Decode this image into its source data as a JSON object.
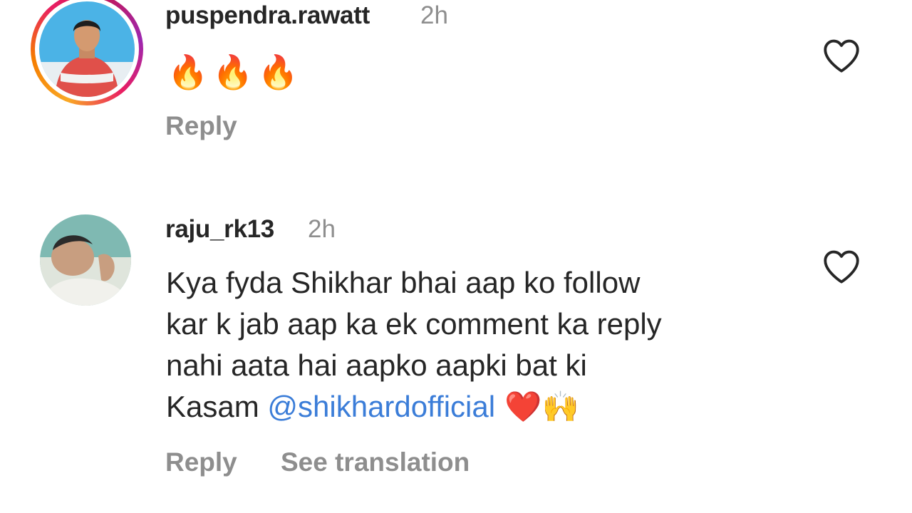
{
  "comments": [
    {
      "username": "puspendra.rawatt",
      "time": "2h",
      "text": "🔥🔥🔥",
      "actions": {
        "reply": "Reply"
      }
    },
    {
      "username": "raju_rk13",
      "time": "2h",
      "text_lines": [
        "Kya fyda Shikhar bhai aap ko follow",
        "kar k jab aap ka ek comment ka reply",
        "nahi aata hai aapko aapki bat ki",
        "Kasam "
      ],
      "mention": "@shikhardofficial",
      "emoji_tail": " ❤️🙌",
      "actions": {
        "reply": "Reply",
        "see_translation": "See translation"
      }
    }
  ],
  "icons": {
    "like": "heart-outline-icon"
  },
  "colors": {
    "text": "#262626",
    "muted": "#8e8e8e",
    "mention": "#3b7dd8"
  }
}
